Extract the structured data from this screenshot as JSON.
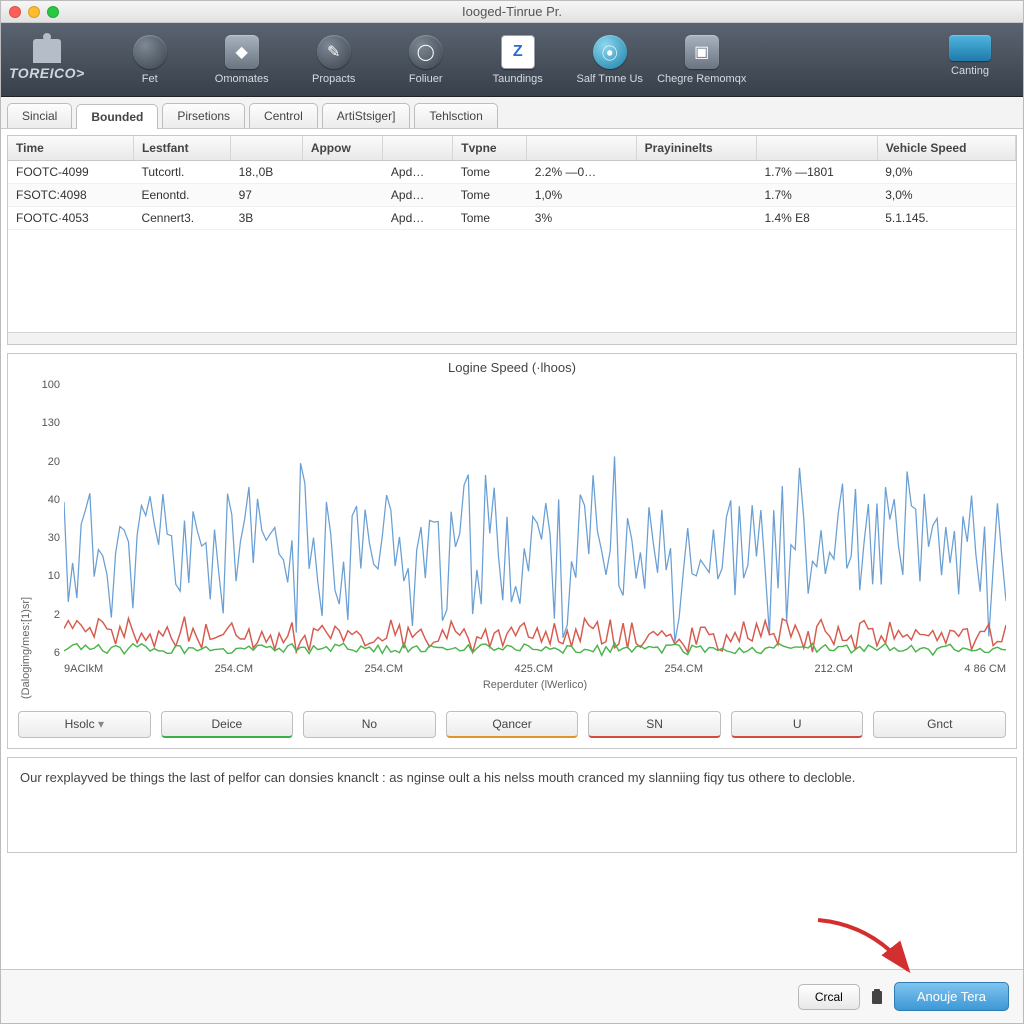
{
  "window_title": "Iooged-Tinrue Pr.",
  "logo_text": "TOREICO>",
  "toolbar": [
    {
      "label": "Fet"
    },
    {
      "label": "Omomates"
    },
    {
      "label": "Propacts"
    },
    {
      "label": "Foliuer"
    },
    {
      "label": "Taundings"
    },
    {
      "label": "Salf Tmne Us"
    },
    {
      "label": "Chegre Remomqx"
    },
    {
      "label": "Canting"
    }
  ],
  "tabs": [
    {
      "label": "Sincial",
      "active": false
    },
    {
      "label": "Bounded",
      "active": true
    },
    {
      "label": "Pirsetions",
      "active": false
    },
    {
      "label": "Centrol",
      "active": false
    },
    {
      "label": "ArtiStsiger]",
      "active": false
    },
    {
      "label": "Tehlsction",
      "active": false
    }
  ],
  "table": {
    "columns": [
      "Time",
      "Lestfant",
      "",
      "Appow",
      "",
      "Tvpne",
      "",
      "Prayininelts",
      "",
      "Vehicle Speed"
    ],
    "rows": [
      [
        "FOOTC-4099",
        "Tutcortl.",
        "18.,0B",
        "",
        "Apd…",
        "Tome",
        "2.2%  —0…",
        "",
        "1.7%  —1801",
        "9,0%"
      ],
      [
        "FSOTC:4098",
        "Eenontd.",
        "97",
        "",
        "Apd…",
        "Tome",
        "1,0%",
        "",
        "1.7%",
        "3,0%"
      ],
      [
        "FOOTC·4053",
        "Cennert3.",
        "3B",
        "",
        "Apd…",
        "Tome",
        "3%",
        "",
        "1.4%       E8",
        "5.1.145."
      ]
    ]
  },
  "chart_buttons": [
    {
      "label": "Hsolc",
      "cls": "drop"
    },
    {
      "label": "Deice",
      "cls": "g"
    },
    {
      "label": "No",
      "cls": ""
    },
    {
      "label": "Qancer",
      "cls": "o"
    },
    {
      "label": "SN",
      "cls": "r"
    },
    {
      "label": "U",
      "cls": "r"
    },
    {
      "label": "Gnct",
      "cls": ""
    }
  ],
  "message": "Our rexplayved be things the last of pelfor can donsies knanclt : as nginse oult a his nelss mouth cranced my slanniing fiqy tus othere to decloble.",
  "footer": {
    "cancel": "Crcal",
    "primary": "Anouje Tera"
  },
  "chart_data": {
    "type": "line",
    "title": "Logine Speed (·lhoos)",
    "xlabel": "Reperduter (lWerlico)",
    "ylabel": "(Dalogimg/mes:[1)sr]",
    "yticks": [
      100,
      130,
      20,
      40,
      30,
      10,
      2,
      6
    ],
    "xticks": [
      "9ACIkM",
      "254.CM",
      "254.CM",
      "425.CM",
      "254.CM",
      "212.CM",
      "4 86 CM"
    ],
    "ylim": [
      0,
      140
    ],
    "series": [
      {
        "name": "blue",
        "color": "#6a9fd4",
        "baseline": 55,
        "amplitude": 30,
        "detail": "noisy"
      },
      {
        "name": "red",
        "color": "#d65b4e",
        "baseline": 12,
        "amplitude": 6,
        "detail": "noisy-low"
      },
      {
        "name": "green",
        "color": "#4bb34b",
        "baseline": 5,
        "amplitude": 2,
        "detail": "flat-noisy"
      }
    ]
  }
}
